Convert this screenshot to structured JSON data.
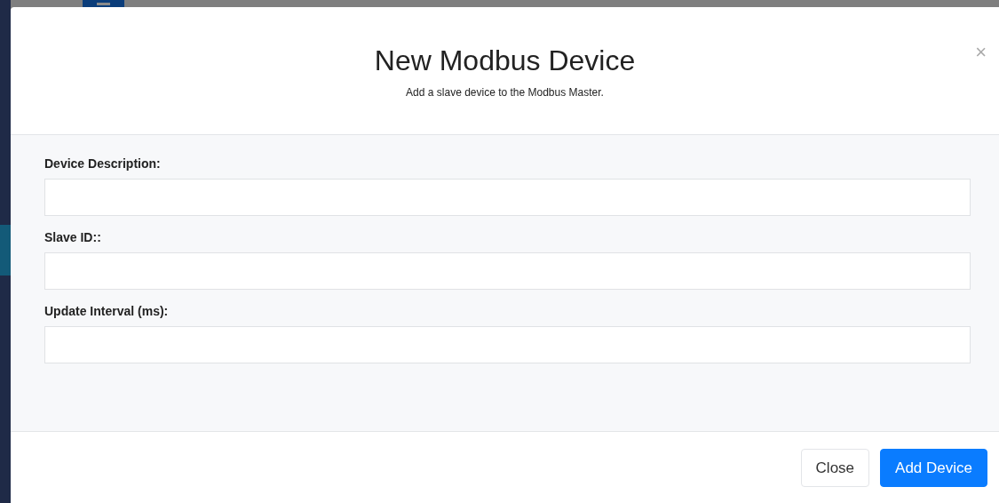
{
  "modal": {
    "title": "New Modbus Device",
    "subtitle": "Add a slave device to the Modbus Master.",
    "close_symbol": "×",
    "fields": [
      {
        "label": "Device Description:"
      },
      {
        "label": "Slave ID::"
      },
      {
        "label": "Update Interval (ms):"
      }
    ],
    "buttons": [
      {
        "label": "Close",
        "kind": "secondary"
      },
      {
        "label": "Add Device",
        "kind": "primary"
      }
    ]
  }
}
